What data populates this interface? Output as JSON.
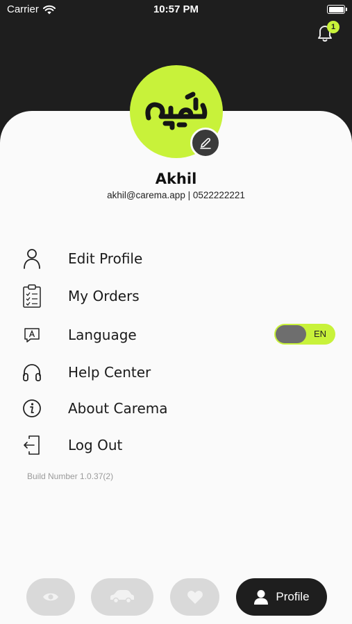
{
  "status_bar": {
    "carrier": "Carrier",
    "time": "10:57 PM"
  },
  "notifications": {
    "badge_count": "1"
  },
  "profile": {
    "name": "Akhil",
    "contact": "akhil@carema.app | 0522222221"
  },
  "menu": {
    "items": [
      {
        "label": "Edit Profile",
        "icon": "person-icon"
      },
      {
        "label": "My Orders",
        "icon": "clipboard-icon"
      },
      {
        "label": "Language",
        "icon": "language-icon"
      },
      {
        "label": "Help Center",
        "icon": "headphones-icon"
      },
      {
        "label": "About Carema",
        "icon": "info-icon"
      },
      {
        "label": "Log Out",
        "icon": "logout-icon"
      }
    ],
    "language_toggle": {
      "value": "EN"
    }
  },
  "build_number": "Build Number 1.0.37(2)",
  "tab_bar": {
    "tabs": [
      {
        "icon": "eye-icon"
      },
      {
        "icon": "car-icon"
      },
      {
        "icon": "heart-icon"
      },
      {
        "icon": "profile-icon",
        "label": "Profile"
      }
    ]
  },
  "colors": {
    "accent": "#c8f23a",
    "dark": "#1e1e1e",
    "inactive_tab": "#d9d9d9"
  }
}
